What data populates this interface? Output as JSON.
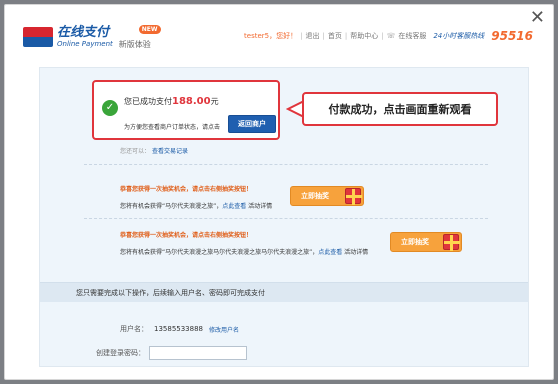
{
  "header": {
    "brand_zh": "在线支付",
    "brand_en": "Online Payment",
    "beta_label": "新版体验",
    "badge": "NEW",
    "user": "tester5，您好！",
    "links": [
      "退出",
      "首页",
      "帮助中心",
      "在线客服"
    ],
    "hotline_label": "24小时客服热线",
    "hotline": "95516"
  },
  "success": {
    "message_prefix": "您已成功支付",
    "amount": "188.00",
    "unit": "元",
    "sub_text": "为方便您查看商户订单状态，请点击",
    "back_button": "返回商户"
  },
  "view_record": {
    "prefix": "您还可以：",
    "link": "查看交易记录"
  },
  "callout": "付款成功，点击画面重新观看",
  "promos": [
    {
      "title": "恭喜您获得一次抽奖机会，请点击右侧抽奖按钮！",
      "desc": "您将有机会获得“马尔代夫浪漫之旅”",
      "link": "点此查看",
      "suffix": "活动详情",
      "button": "立即抽奖"
    },
    {
      "title": "恭喜您获得一次抽奖机会，请点击右侧抽奖按钮！",
      "desc": "您将有机会获得“马尔代夫浪漫之旅马尔代夫浪漫之旅马尔代夫浪漫之旅”",
      "link": "点此查看",
      "suffix": "活动详情",
      "button": "立即抽奖"
    }
  ],
  "lower": {
    "heading": "您只需要完成以下操作，后续输入用户名、密码即可完成支付",
    "username_label": "用户名：",
    "username_value": "13585533888",
    "username_link": "修改用户名",
    "password_label": "创建登录密码："
  },
  "colors": {
    "accent": "#1f5fb0",
    "alert": "#e0353c",
    "promo": "#f7a23c"
  }
}
